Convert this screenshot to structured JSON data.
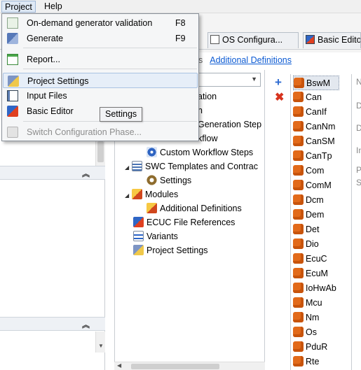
{
  "menubar": {
    "items": [
      {
        "label": "Project"
      },
      {
        "label": "Help"
      }
    ]
  },
  "project_menu": {
    "items": [
      {
        "label": "On-demand generator validation",
        "shortcut": "F8",
        "icon": "validation-check-icon"
      },
      {
        "label": "Generate",
        "shortcut": "F9",
        "icon": "generate-stack-icon"
      },
      {
        "label": "Report...",
        "icon": "report-icon"
      },
      {
        "label": "Project Settings",
        "icon": "project-settings-icon"
      },
      {
        "label": "Input Files",
        "icon": "input-files-icon"
      },
      {
        "label": "Basic Editor",
        "icon": "basic-editor-icon"
      },
      {
        "label": "Switch Configuration Phase...",
        "icon": "switch-phase-icon",
        "disabled": true
      }
    ],
    "tooltip": "Settings"
  },
  "tabs": [
    {
      "label": "OS Configura..."
    },
    {
      "label": "Basic Edito"
    }
  ],
  "breadcrumb": {
    "separator": "s",
    "link": "Additional Definitions"
  },
  "tree": {
    "rows": [
      {
        "label": "ation"
      },
      {
        "label": "n"
      },
      {
        "label": "Generation Step"
      },
      {
        "label": "kflow"
      },
      {
        "label": "Custom Workflow Steps"
      },
      {
        "label": "SWC Templates and Contrac"
      },
      {
        "label": "Settings"
      },
      {
        "label": "Modules"
      },
      {
        "label": "Additional Definitions"
      },
      {
        "label": "ECUC File References"
      },
      {
        "label": "Variants"
      },
      {
        "label": "Project Settings"
      }
    ]
  },
  "toolbar_icons": {
    "add": "+",
    "remove": "✖"
  },
  "modules_list": [
    "BswM",
    "Can",
    "CanIf",
    "CanNm",
    "CanSM",
    "CanTp",
    "Com",
    "ComM",
    "Dcm",
    "Dem",
    "Det",
    "Dio",
    "EcuC",
    "EcuM",
    "IoHwAb",
    "Mcu",
    "Nm",
    "Os",
    "PduR",
    "Rte"
  ],
  "right_edge_text": [
    "N",
    "D",
    "D",
    "In",
    "P",
    "S"
  ],
  "colors": {
    "link": "#0b5ad3",
    "menu_hover": "#e6eef8",
    "module_icon": "#e26a1a"
  }
}
